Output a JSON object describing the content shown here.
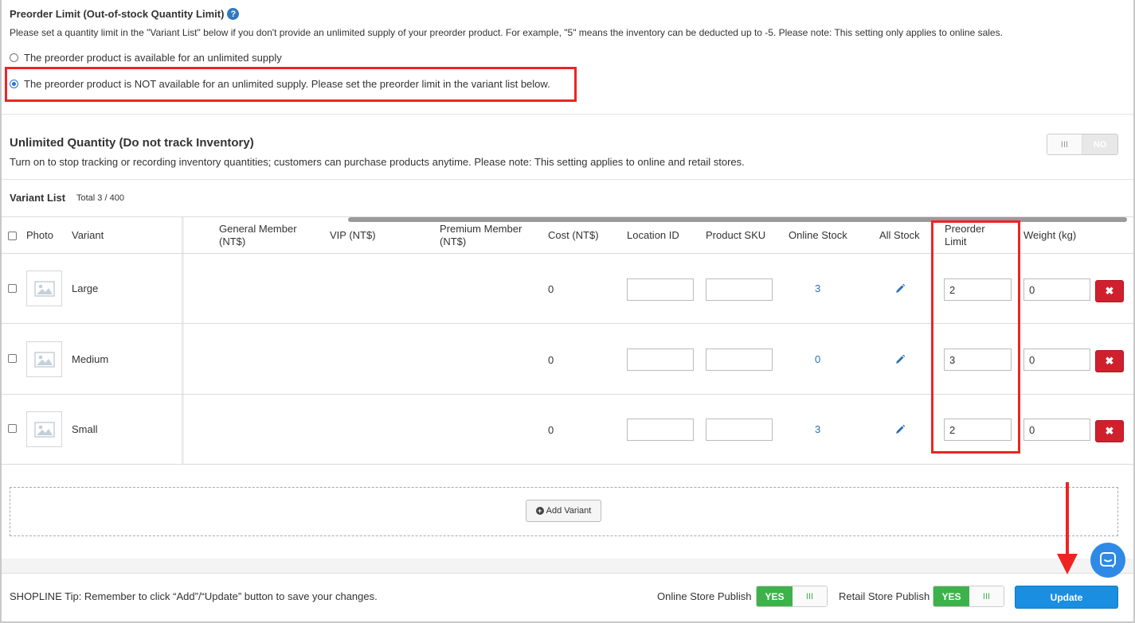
{
  "preorder": {
    "title": "Preorder Limit (Out-of-stock Quantity Limit)",
    "help_glyph": "?",
    "description": "Please set a quantity limit in the \"Variant List\" below if you don't provide an unlimited supply of your preorder product. For example, \"5\" means the inventory can be deducted up to -5. Please note: This setting only applies to online sales.",
    "option_unlimited": "The preorder product is available for an unlimited supply",
    "option_limited": "The preorder product is NOT available for an unlimited supply. Please set the preorder limit in the variant list below.",
    "selected": "limited"
  },
  "unlimited_quantity": {
    "title": "Unlimited Quantity (Do not track Inventory)",
    "description": "Turn on to stop tracking or recording inventory quantities; customers can purchase products anytime. Please note: This setting applies to online and retail stores.",
    "toggle_state": "NO",
    "toggle_knob": "III"
  },
  "variant_list": {
    "title": "Variant List",
    "total": "Total 3 / 400",
    "headers": {
      "photo": "Photo",
      "variant": "Variant",
      "general_member": "General Member (NT$)",
      "vip": "VIP (NT$)",
      "premium_member": "Premium Member (NT$)",
      "cost": "Cost (NT$)",
      "location_id": "Location ID",
      "product_sku": "Product SKU",
      "online_stock": "Online Stock",
      "all_stock": "All Stock",
      "preorder_limit": "Preorder Limit",
      "weight": "Weight (kg)"
    },
    "rows": [
      {
        "variant": "Large",
        "cost": "0",
        "location_id": "",
        "sku": "",
        "online_stock": "3",
        "preorder_limit": "2",
        "weight": "0"
      },
      {
        "variant": "Medium",
        "cost": "0",
        "location_id": "",
        "sku": "",
        "online_stock": "0",
        "preorder_limit": "3",
        "weight": "0"
      },
      {
        "variant": "Small",
        "cost": "0",
        "location_id": "",
        "sku": "",
        "online_stock": "3",
        "preorder_limit": "2",
        "weight": "0"
      }
    ],
    "delete_glyph": "✖"
  },
  "add_variant_label": "Add Variant",
  "footer": {
    "tip": "SHOPLINE Tip: Remember to click “Add”/“Update” button to save your changes.",
    "online_publish_label": "Online Store Publish",
    "online_publish_state": "YES",
    "retail_publish_label": "Retail Store Publish",
    "retail_publish_state": "YES",
    "toggle_knob": "III",
    "update_label": "Update"
  },
  "colors": {
    "annotation_red": "#ee2424",
    "publish_green": "#3db24b",
    "update_blue": "#1a8ee0",
    "delete_red": "#d0202e",
    "link_blue": "#2a6fb8"
  }
}
